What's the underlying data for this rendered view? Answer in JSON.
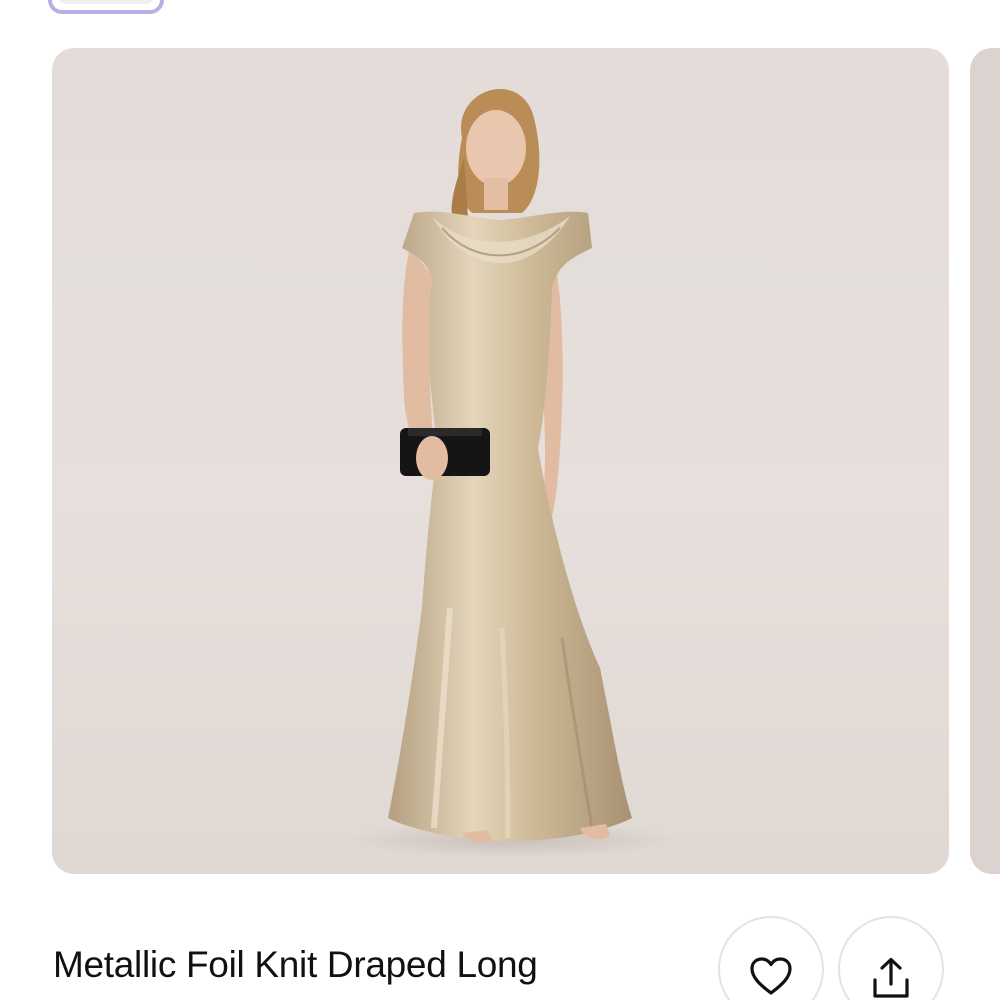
{
  "product": {
    "title": "Metallic Foil Knit Draped Long",
    "image_alt": "Model wearing metallic gold draped long gown holding black clutch"
  },
  "actions": {
    "favorite_icon": "heart-icon",
    "share_icon": "share-icon"
  },
  "colors": {
    "thumbnail_selected_border": "#b7b0e6",
    "image_background": "#e4ddd9",
    "dress_gold": "#cbb89a",
    "clutch_black": "#151515"
  }
}
